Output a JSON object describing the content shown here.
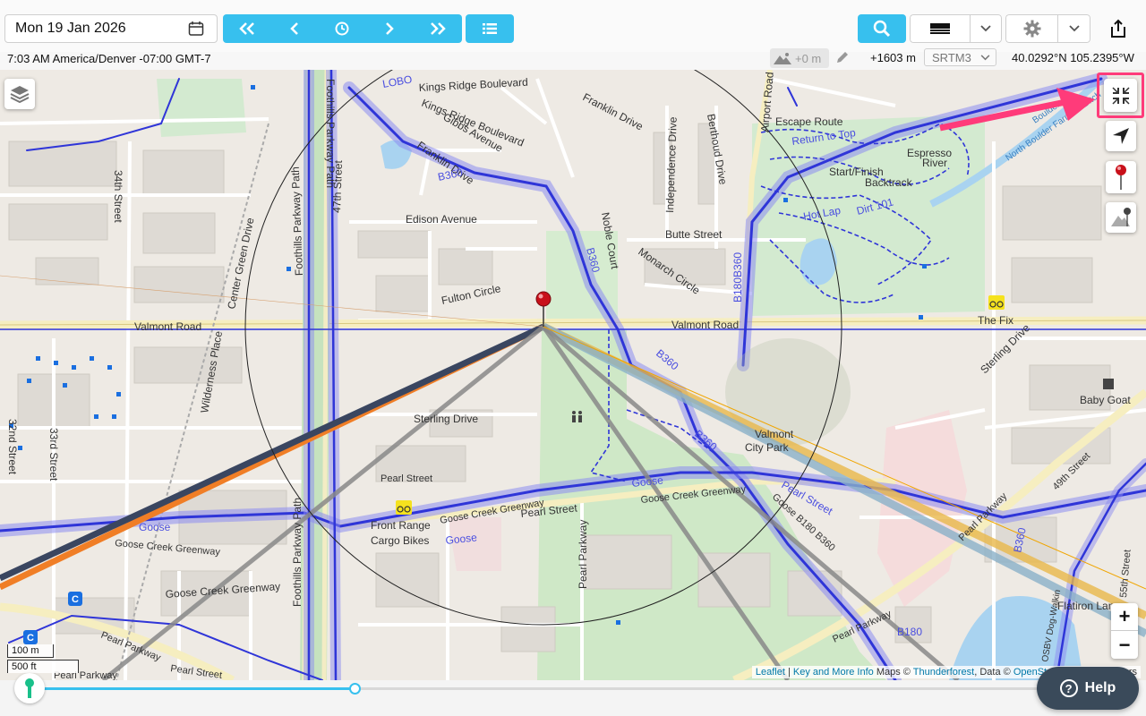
{
  "header": {
    "date": "Mon 19 Jan 2026",
    "timezone_line": "7:03 AM America/Denver -07:00 GMT-7",
    "elevation_offset": "+0 m",
    "elevation": "+1603 m",
    "dem_source": "SRTM3",
    "coordinates": "40.0292°N 105.2395°W"
  },
  "icons": {
    "calendar": "calendar-icon",
    "fast_back": "double-chevron-left-icon",
    "back": "chevron-left-icon",
    "now": "clock-icon",
    "forward": "chevron-right-icon",
    "fast_forward": "double-chevron-right-icon",
    "list": "list-icon",
    "search": "search-icon",
    "settings": "gear-icon",
    "share": "share-icon"
  },
  "map": {
    "labels": [
      {
        "id": "kings-ridge-1",
        "text": "Kings Ridge Boulevard"
      },
      {
        "id": "kings-ridge-2",
        "text": "Kings Ridge Boulevard"
      },
      {
        "id": "lobo",
        "text": "LOBO"
      },
      {
        "id": "gibbs",
        "text": "Gibbs Avenue"
      },
      {
        "id": "franklin-1",
        "text": "Franklin Drive"
      },
      {
        "id": "franklin-2",
        "text": "Franklin Drive"
      },
      {
        "id": "b360-1",
        "text": "B360"
      },
      {
        "id": "noble",
        "text": "Noble Court"
      },
      {
        "id": "independence",
        "text": "Independence Drive"
      },
      {
        "id": "berthoud",
        "text": "Berthoud Drive"
      },
      {
        "id": "airport",
        "text": "Airport Road"
      },
      {
        "id": "escape",
        "text": "Escape Route"
      },
      {
        "id": "return",
        "text": "Return to Top"
      },
      {
        "id": "espresso",
        "text": "Espresso"
      },
      {
        "id": "river",
        "text": "River"
      },
      {
        "id": "start",
        "text": "Start/Finish"
      },
      {
        "id": "backtrack",
        "text": "Backtrack"
      },
      {
        "id": "hotlap",
        "text": "Hot Lap"
      },
      {
        "id": "dirt",
        "text": "Dirt 101"
      },
      {
        "id": "edison",
        "text": "Edison Avenue"
      },
      {
        "id": "butte",
        "text": "Butte Street"
      },
      {
        "id": "monarch",
        "text": "Monarch Circle"
      },
      {
        "id": "fulton",
        "text": "Fulton Circle"
      },
      {
        "id": "b360-2",
        "text": "B360"
      },
      {
        "id": "b180b360",
        "text": "B180B360"
      },
      {
        "id": "center-green",
        "text": "Center Green Drive"
      },
      {
        "id": "34th",
        "text": "34th Street"
      },
      {
        "id": "foothills-1",
        "text": "Foothills Parkway Path"
      },
      {
        "id": "foothills-2",
        "text": "Foothills Parkway Path"
      },
      {
        "id": "47th",
        "text": "47th Street"
      },
      {
        "id": "valmont-1",
        "text": "Valmont Road"
      },
      {
        "id": "valmont-2",
        "text": "Valmont Road"
      },
      {
        "id": "thefix",
        "text": "The Fix"
      },
      {
        "id": "sterling-drive-1",
        "text": "Sterling Drive"
      },
      {
        "id": "baby-goat",
        "text": "Baby Goat"
      },
      {
        "id": "wilderness",
        "text": "Wilderness Place"
      },
      {
        "id": "sterling-drive-2",
        "text": "Sterling Drive"
      },
      {
        "id": "b360-3",
        "text": "B360"
      },
      {
        "id": "b360-4",
        "text": "B360"
      },
      {
        "id": "valmont-park-1",
        "text": "Valmont"
      },
      {
        "id": "valmont-park-2",
        "text": "City Park"
      },
      {
        "id": "33rd",
        "text": "33rd Street"
      },
      {
        "id": "32nd",
        "text": "32nd Street"
      },
      {
        "id": "goose-1",
        "text": "Goose"
      },
      {
        "id": "goose-creek-1",
        "text": "Goose Creek Greenway"
      },
      {
        "id": "goose-creek-2",
        "text": "Goose Creek Greenway"
      },
      {
        "id": "pearl-1",
        "text": "Pearl Street"
      },
      {
        "id": "front-range-1",
        "text": "Front Range"
      },
      {
        "id": "front-range-2",
        "text": "Cargo Bikes"
      },
      {
        "id": "goose-2",
        "text": "Goose"
      },
      {
        "id": "goose-3",
        "text": "Goose"
      },
      {
        "id": "goose-creek-3",
        "text": "Goose Creek Greenway"
      },
      {
        "id": "pearl-2",
        "text": "Pearl Street"
      },
      {
        "id": "goose-b180",
        "text": "Goose B180 B360"
      },
      {
        "id": "goose-creek-4",
        "text": "Goose Creek Greenway"
      },
      {
        "id": "pearl-parkway-1",
        "text": "Pearl Parkway"
      },
      {
        "id": "pearl-3",
        "text": "Pearl Street"
      },
      {
        "id": "pearl-parkway-2",
        "text": "Pearl Parkway"
      },
      {
        "id": "pearl-parkway-3",
        "text": "Pearl Parkway"
      },
      {
        "id": "49th",
        "text": "49th Street"
      },
      {
        "id": "pearl-parkway-4",
        "text": "Pearl Parkway"
      },
      {
        "id": "flatiron",
        "text": "Flatiron Lane"
      },
      {
        "id": "b180",
        "text": "B180"
      },
      {
        "id": "b360-5",
        "text": "B360"
      },
      {
        "id": "pearl-parkway-5",
        "text": "Pearl Parkway"
      },
      {
        "id": "pearl-street-4",
        "text": "Pearl Street"
      },
      {
        "id": "foothills-3",
        "text": "Foothills Parkway Path"
      },
      {
        "id": "north-boulder",
        "text": "North Boulder Farmers Ditch"
      },
      {
        "id": "boulder",
        "text": "Boulder"
      },
      {
        "id": "55th",
        "text": "55th Street"
      },
      {
        "id": "dog-walk",
        "text": "OSBV Dog-Walkin"
      }
    ],
    "scale_metric": "100 m",
    "scale_imperial": "500 ft",
    "zoom_in": "+",
    "zoom_out": "−",
    "attribution": {
      "leaflet": "Leaflet",
      "sep1": " | ",
      "key_info": "Key and More Info",
      "maps": " Maps © ",
      "thunderforest": "Thunderforest",
      "data": ", Data © ",
      "osm": "OpenStreetMap",
      "contributors": " contributors"
    },
    "control_icons": {
      "layers": "layers-icon",
      "fullscreen": "exit-fullscreen-icon",
      "locate": "navigation-arrow-icon",
      "marker": "red-pin-icon",
      "elevation_marker": "mountain-pin-icon"
    }
  },
  "timeline": {
    "position_percent": 29
  },
  "help": {
    "label": "Help"
  },
  "colors": {
    "accent": "#37c0ee",
    "highlight": "#ff3b7a",
    "route": "#4a4ee0",
    "sun_line": "#f0a500"
  }
}
